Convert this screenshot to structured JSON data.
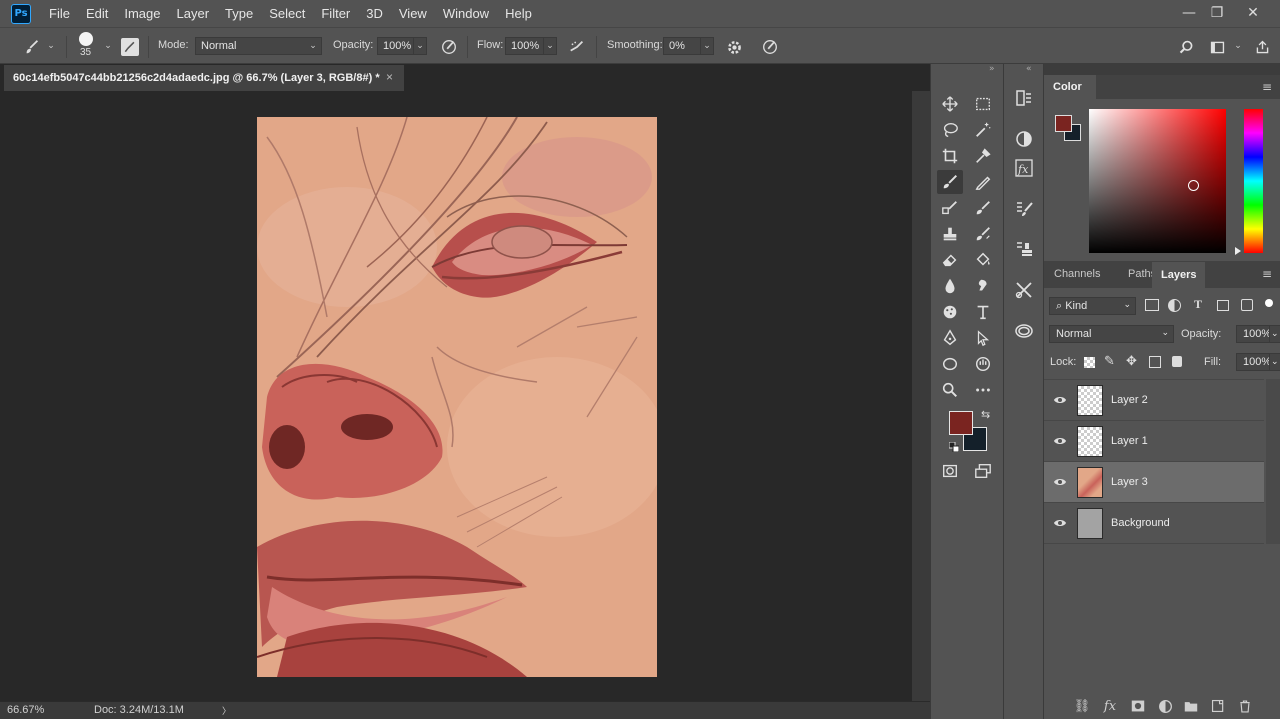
{
  "app": {
    "logo": "Ps"
  },
  "menu": [
    "File",
    "Edit",
    "Image",
    "Layer",
    "Type",
    "Select",
    "Filter",
    "3D",
    "View",
    "Window",
    "Help"
  ],
  "window_controls": {
    "minimize": "—",
    "restore": "❐",
    "close": "✕"
  },
  "options": {
    "brush_size": "35",
    "mode_label": "Mode:",
    "mode_value": "Normal",
    "opacity_label": "Opacity:",
    "opacity_value": "100%",
    "flow_label": "Flow:",
    "flow_value": "100%",
    "smoothing_label": "Smoothing:",
    "smoothing_value": "0%"
  },
  "document": {
    "tab_title": "60c14efb5047c44bb21256c2d4adaedc.jpg @ 66.7% (Layer 3, RGB/8#) *",
    "close": "×"
  },
  "status": {
    "zoom": "66.67%",
    "doc_size": "Doc: 3.24M/13.1M",
    "arrow": "〉"
  },
  "colors": {
    "foreground": "#7a2420",
    "background": "#14202a",
    "accent": "#31a8ff"
  },
  "color_panel": {
    "title": "Color"
  },
  "layers_panel": {
    "tabs": [
      "Channels",
      "Paths",
      "Layers"
    ],
    "filter_label": "Kind",
    "blend_mode": "Normal",
    "opacity_label": "Opacity:",
    "opacity_value": "100%",
    "lock_label": "Lock:",
    "fill_label": "Fill:",
    "fill_value": "100%",
    "layers": [
      {
        "name": "Layer 2",
        "thumb": "transparent",
        "selected": false
      },
      {
        "name": "Layer 1",
        "thumb": "transparent",
        "selected": false
      },
      {
        "name": "Layer 3",
        "thumb": "painting",
        "selected": true
      },
      {
        "name": "Background",
        "thumb": "gray",
        "selected": false
      }
    ],
    "bottom_icons": [
      "link-icon",
      "fx-icon",
      "mask-icon",
      "adjustment-icon",
      "group-icon",
      "new-layer-icon",
      "trash-icon"
    ]
  }
}
